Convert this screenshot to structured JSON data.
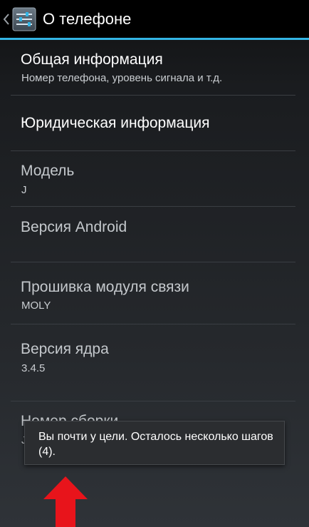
{
  "action_bar": {
    "title": "О телефоне",
    "up_icon": "chevron-left-icon",
    "app_icon": "settings-sliders-icon"
  },
  "preferences": [
    {
      "title": "Общая информация",
      "summary": "Номер телефона, уровень сигнала и т.д."
    },
    {
      "title": "Юридическая информация",
      "summary": ""
    },
    {
      "title": "Модель",
      "summary": "J"
    },
    {
      "title": "Версия Android",
      "summary": ""
    },
    {
      "title": "Прошивка модуля связи",
      "summary": "MOLY"
    },
    {
      "title": "Версия ядра",
      "summary": "3.4.5"
    },
    {
      "title": "Номер сборки",
      "summary": "J"
    }
  ],
  "toast": {
    "text": "Вы почти у цели. Осталось несколько шагов (4)."
  },
  "annotation": {
    "arrow_icon": "red-up-arrow-icon",
    "arrow_color": "#e8141b"
  },
  "colors": {
    "accent": "#33b5e5",
    "action_bar": "#000000"
  }
}
